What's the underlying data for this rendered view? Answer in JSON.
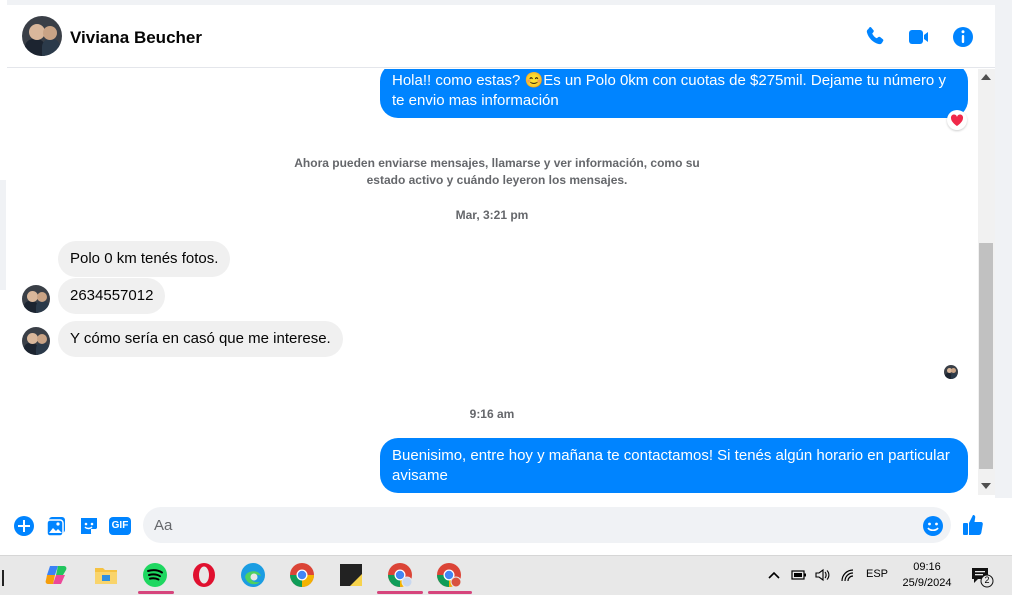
{
  "header": {
    "contact_name": "Viviana Beucher",
    "icons": [
      "phone-icon",
      "video-camera-icon",
      "info-icon"
    ]
  },
  "messages": {
    "out_1": "Hola!! como estas? 😊Es un Polo 0km con cuotas de $275mil. Dejame tu número y te envio mas información",
    "system_notice": "Ahora pueden enviarse mensajes, llamarse y ver información, como su estado activo y cuándo leyeron los mensajes.",
    "time_1": "Mar, 3:21 pm",
    "in_1": "Polo 0 km tenés fotos.",
    "in_2": "2634557012",
    "in_3": "Y cómo sería en casó que me interese.",
    "time_2": "9:16 am",
    "out_2": "Buenisimo, entre hoy y mañana te contactamos! Si tenés algún horario en particular avisame"
  },
  "reaction": "❤️",
  "composer": {
    "placeholder": "Aa",
    "icons": [
      "plus-icon",
      "photo-icon",
      "sticker-icon",
      "gif-icon",
      "emoji-icon",
      "thumbs-up-icon"
    ],
    "gif_label": "GIF"
  },
  "taskbar": {
    "apps": [
      "task-view-icon",
      "copilot-icon",
      "file-explorer-icon",
      "spotify-icon",
      "opera-icon",
      "edge-icon",
      "chrome-icon",
      "sticky-notes-icon",
      "chrome-profile-y-icon",
      "chrome-profile-r-icon"
    ],
    "tray_lang": "ESP",
    "time": "09:16",
    "date": "25/9/2024",
    "notifications": "2"
  },
  "colors": {
    "accent": "#0084ff",
    "bubble_in": "#f0f0f0",
    "muted_text": "#65676b"
  }
}
